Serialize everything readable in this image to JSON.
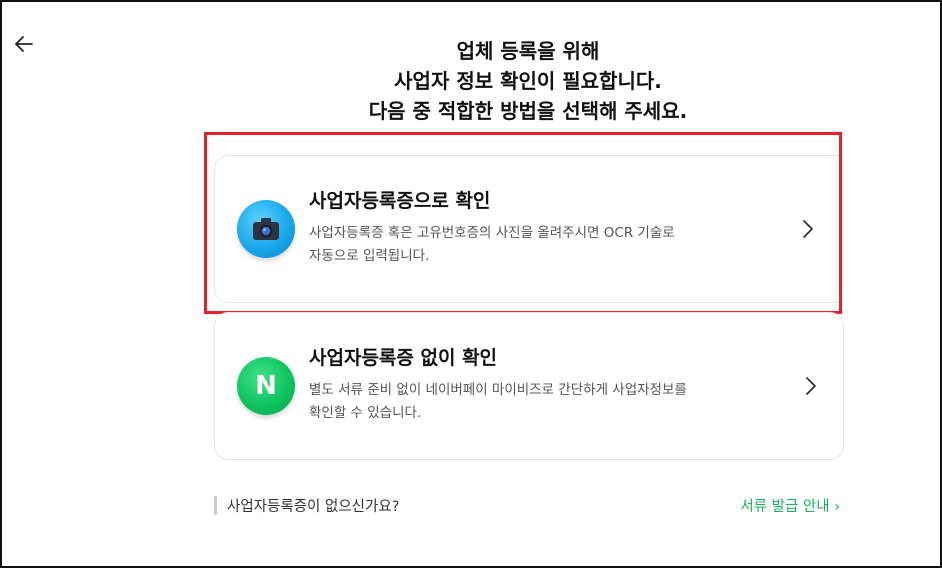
{
  "header": {
    "title_lines": [
      "업체 등록을 위해",
      "사업자 정보 확인이 필요합니다.",
      "다음 중 적합한 방법을 선택해 주세요."
    ]
  },
  "options": [
    {
      "title": "사업자등록증으로 확인",
      "desc_lines": [
        "사업자등록증 혹은 고유번호증의 사진을 올려주시면 OCR 기술로",
        "자동으로 입력됩니다."
      ],
      "icon": "camera-icon"
    },
    {
      "title": "사업자등록증 없이 확인",
      "desc_lines": [
        "별도 서류 준비 없이 네이버페이 마이비즈로 간단하게 사업자정보를",
        "확인할 수 있습니다."
      ],
      "icon": "naver-logo-icon",
      "icon_text": "N"
    }
  ],
  "footer": {
    "question": "사업자등록증이 없으신가요?",
    "link": "서류 발급 안내 ›"
  },
  "colors": {
    "highlight": "#e8202a",
    "link": "#19b45c",
    "camera": "#1aa7ea",
    "naver": "#10c45f"
  }
}
